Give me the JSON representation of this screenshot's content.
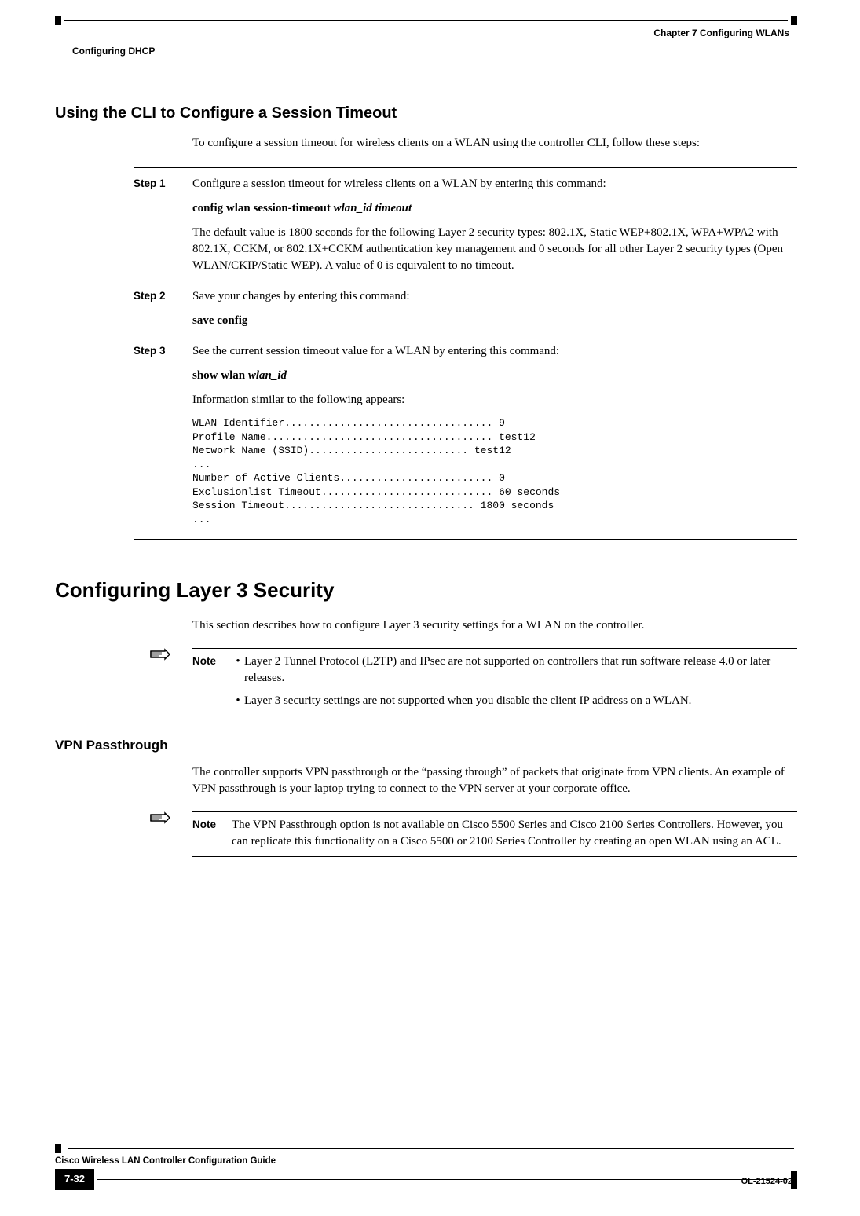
{
  "header": {
    "chapter_right": "Chapter 7      Configuring WLANs",
    "section_left": "Configuring DHCP"
  },
  "h2": "Using the CLI to Configure a Session Timeout",
  "intro": "To configure a session timeout for wireless clients on a WLAN using the controller CLI, follow these steps:",
  "steps": {
    "s1": {
      "label": "Step 1",
      "l1": "Configure a session timeout for wireless clients on a WLAN by entering this command:",
      "cmd": "config wlan session-timeout ",
      "cmd_arg": "wlan_id timeout",
      "l2": "The default value is 1800 seconds for the following Layer 2 security types: 802.1X, Static WEP+802.1X, WPA+WPA2 with 802.1X, CCKM, or 802.1X+CCKM authentication key management and 0 seconds for all other Layer 2 security types (Open WLAN/CKIP/Static WEP). A value of 0 is equivalent to no timeout."
    },
    "s2": {
      "label": "Step 2",
      "l1": "Save your changes by entering this command:",
      "cmd": "save config"
    },
    "s3": {
      "label": "Step 3",
      "l1": "See the current session timeout value for a WLAN by entering this command:",
      "cmd": "show wlan ",
      "cmd_arg": "wlan_id",
      "l2": "Information similar to the following appears:",
      "cli": "WLAN Identifier.................................. 9\nProfile Name..................................... test12\nNetwork Name (SSID).......................... test12\n...\nNumber of Active Clients......................... 0\nExclusionlist Timeout............................ 60 seconds\nSession Timeout............................... 1800 seconds\n..."
    }
  },
  "h1": "Configuring Layer 3 Security",
  "l3_intro": "This section describes how to configure Layer 3 security settings for a WLAN on the controller.",
  "note1": {
    "label": "Note",
    "b1": "Layer 2 Tunnel Protocol (L2TP) and IPsec are not supported on controllers that run software release 4.0 or later releases.",
    "b2": "Layer 3 security settings are not supported when you disable the client IP address on a WLAN."
  },
  "h3": "VPN Passthrough",
  "vpn_p": "The controller supports VPN passthrough or the “passing through” of packets that originate from VPN clients. An example of VPN passthrough is your laptop trying to connect to the VPN server at your corporate office.",
  "note2": {
    "label": "Note",
    "body": "The VPN Passthrough option is not available on Cisco 5500 Series and Cisco 2100 Series Controllers. However, you can replicate this functionality on a Cisco 5500 or 2100 Series Controller by creating an open WLAN using an ACL."
  },
  "footer": {
    "title": "Cisco Wireless LAN Controller Configuration Guide",
    "page": "7-32",
    "doc": "OL-21524-02"
  }
}
